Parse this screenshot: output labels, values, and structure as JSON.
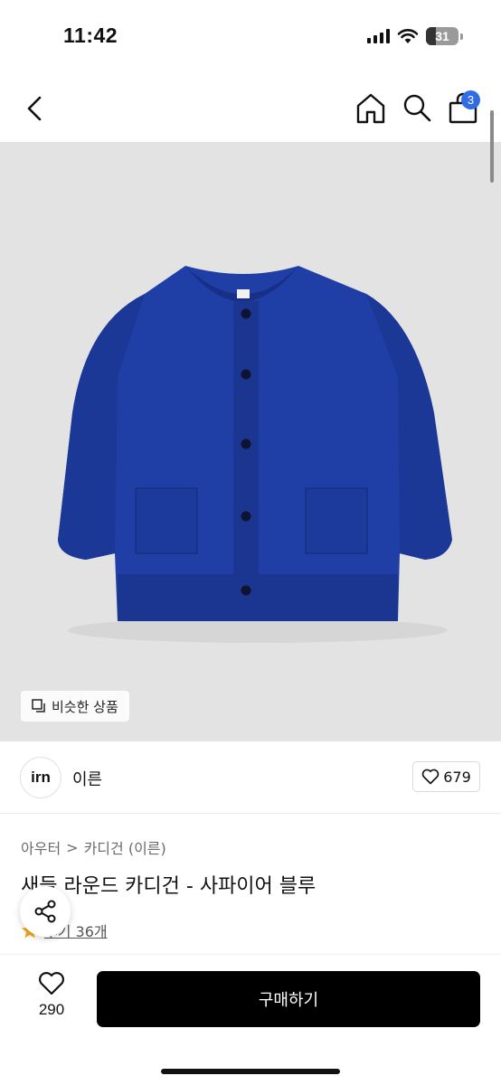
{
  "status_bar": {
    "time": "11:42",
    "battery": "31",
    "battery_level": 0.31
  },
  "nav": {
    "cart_count": "3",
    "icons": [
      "chevron-left-icon",
      "home-icon",
      "search-icon",
      "shopping-bag-icon"
    ]
  },
  "product_image": {
    "similar_label": "비슷한 상품",
    "background_color": "#e3e3e3",
    "garment_color": "#1f3fa6"
  },
  "brand": {
    "logo_text": "irn",
    "name": "이른",
    "like_count": "679"
  },
  "breadcrumb": {
    "category": "아우터",
    "separator": ">",
    "subcategory": "카디건 (이른)"
  },
  "product": {
    "title": "새들 라운드 카디건 - 사파이어 블루",
    "review_label": "후기 36개"
  },
  "bottom_bar": {
    "wish_count": "290",
    "buy_label": "구매하기"
  },
  "colors": {
    "accent": "#2f6ce6",
    "button": "#000000",
    "star": "#f5a623"
  }
}
